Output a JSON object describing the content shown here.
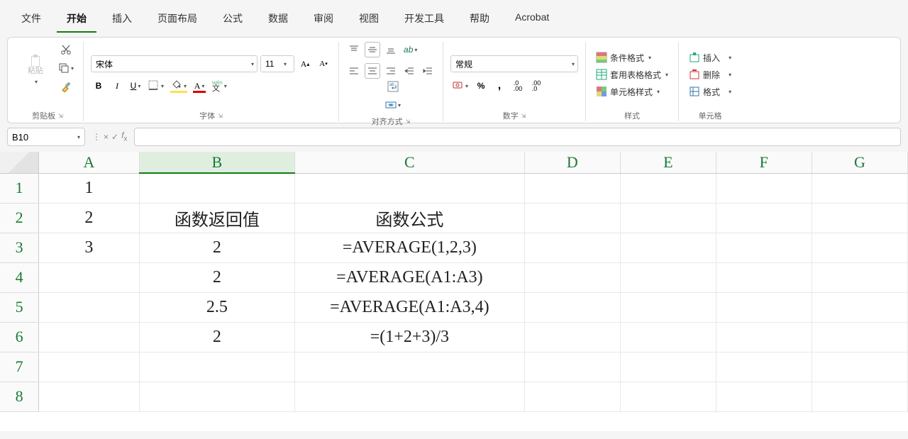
{
  "tabs": [
    "文件",
    "开始",
    "插入",
    "页面布局",
    "公式",
    "数据",
    "审阅",
    "视图",
    "开发工具",
    "帮助",
    "Acrobat"
  ],
  "active_tab_index": 1,
  "ribbon": {
    "clipboard": {
      "paste": "粘贴",
      "label": "剪贴板"
    },
    "font": {
      "name": "宋体",
      "size": "11",
      "label": "字体",
      "ruby_label": "wén"
    },
    "alignment": {
      "label": "对齐方式"
    },
    "number": {
      "format": "常规",
      "label": "数字"
    },
    "styles": {
      "conditional": "条件格式",
      "table": "套用表格格式",
      "cell": "单元格样式",
      "label": "样式"
    },
    "cells": {
      "insert": "插入",
      "delete": "删除",
      "format": "格式",
      "label": "单元格"
    }
  },
  "name_box": "B10",
  "formula_value": "",
  "columns": [
    "A",
    "B",
    "C",
    "D",
    "E",
    "F",
    "G"
  ],
  "rows": [
    "1",
    "2",
    "3",
    "4",
    "5",
    "6",
    "7",
    "8"
  ],
  "cells": {
    "A1": "1",
    "A2": "2",
    "A3": "3",
    "B2": "函数返回值",
    "C2": "函数公式",
    "B3": "2",
    "C3": "=AVERAGE(1,2,3)",
    "B4": "2",
    "C4": "=AVERAGE(A1:A3)",
    "B5": "2.5",
    "C5": "=AVERAGE(A1:A3,4)",
    "B6": "2",
    "C6": "=(1+2+3)/3"
  },
  "selected_col": "B"
}
